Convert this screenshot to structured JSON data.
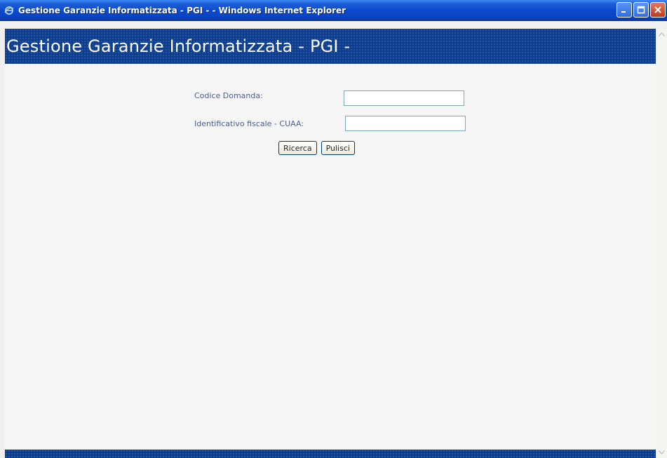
{
  "window": {
    "title": "Gestione Garanzie Informatizzata - PGI - - Windows Internet Explorer",
    "app_icon": "ie-icon",
    "controls": [
      "minimize-icon",
      "maximize-icon",
      "close-icon"
    ]
  },
  "header": {
    "title": "Gestione Garanzie Informatizzata - PGI -"
  },
  "form": {
    "codice_domanda": {
      "label": "Codice Domanda:",
      "value": "",
      "placeholder": ""
    },
    "cuaa": {
      "label": "Identificativo fiscale - CUAA:",
      "value": "",
      "placeholder": ""
    },
    "buttons": {
      "search_label": "Ricerca",
      "clear_label": "Pulisci"
    }
  },
  "colors": {
    "title_bar": "#0a4bd0",
    "header_band": "#0c3d8e",
    "label_text": "#4a5d8a",
    "page_bg": "#f6f6f6"
  }
}
